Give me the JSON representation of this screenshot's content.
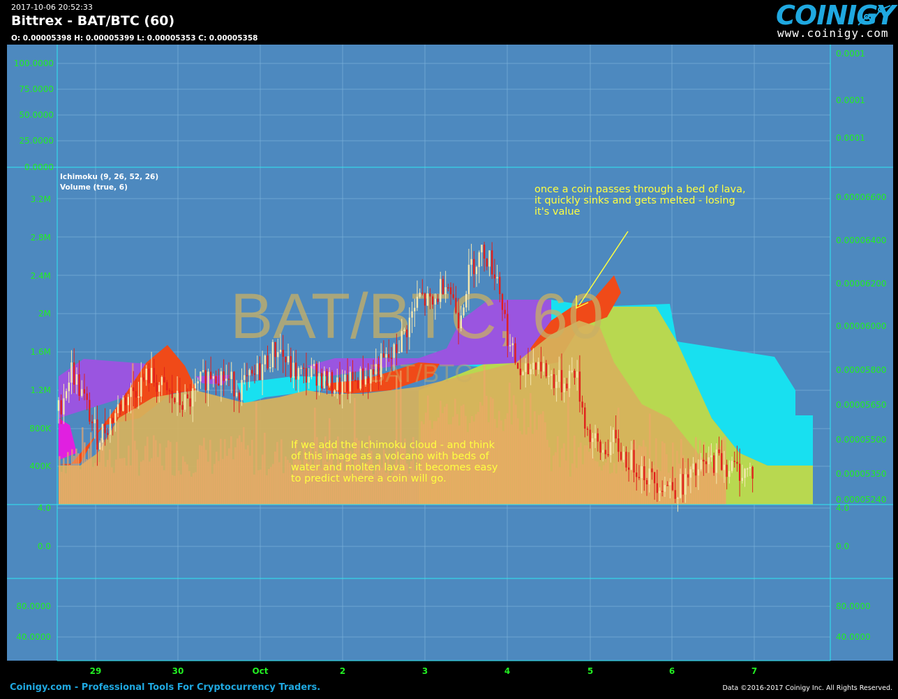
{
  "header": {
    "timestamp": "2017-10-06 20:52:33",
    "title": "Bittrex - BAT/BTC (60)",
    "ohlc": "O: 0.00005398 H: 0.00005399 L: 0.00005353 C: 0.00005358"
  },
  "logo": {
    "word": "COINIGY",
    "url": "www.coinigy.com"
  },
  "footer": {
    "left": "Coinigy.com - Professional Tools For Cryptocurrency Traders.",
    "right": "Data ©2016-2017 Coinigy Inc. All Rights Reserved."
  },
  "colors": {
    "panel_bg": "#4d89bf",
    "grid": "#7ab0d8",
    "axis_line": "#2ee8f0",
    "tick_text": "#22ee22",
    "candle_up": "#f5e8b0",
    "candle_down": "#e0201c",
    "cloud_purple": "#9a55e0",
    "cloud_lava": "#f04a18",
    "cloud_cyan": "#18e0f0",
    "cloud_lime": "#b8d850",
    "volume_fill": "#f0a868",
    "sand": "#d7b25c",
    "magenta": "#e020e0",
    "annotation": "#ffff40",
    "watermark": "#c8b064"
  },
  "chart_data": {
    "type": "candlestick",
    "watermark": "BAT/BTC, 60",
    "watermark_sub": "BAT/BTC",
    "indicators": [
      "Ichimoku (9, 26, 52, 26)",
      "Volume (true, 6)"
    ],
    "x_ticks": [
      "29",
      "30",
      "Oct",
      "2",
      "3",
      "4",
      "5",
      "6",
      "7"
    ],
    "top_panel": {
      "left_ticks": [
        "100.0000",
        "75.0000",
        "50.0000",
        "25.0000",
        "0.0000"
      ],
      "right_ticks": [
        "0.0001",
        "0.0001",
        "0.0001"
      ]
    },
    "main_panel": {
      "left_ticks": [
        "3.2M",
        "2.8M",
        "2.4M",
        "2M",
        "1.6M",
        "1.2M",
        "800K",
        "400K"
      ],
      "right_ticks": [
        "0.00006600",
        "0.00006400",
        "0.00006200",
        "0.00006000",
        "0.00005800",
        "0.00005650",
        "0.00005500",
        "0.00005350",
        "0.00005240"
      ],
      "price_range": [
        5.22e-05,
        6.68e-05
      ],
      "close_series": [
        {
          "x": 0.0,
          "c": 5.65e-05
        },
        {
          "x": 0.25,
          "c": 5.85e-05
        },
        {
          "x": 0.5,
          "c": 5.7e-05
        },
        {
          "x": 0.75,
          "c": 5.52e-05
        },
        {
          "x": 1.0,
          "c": 5.6e-05
        },
        {
          "x": 1.25,
          "c": 5.7e-05
        },
        {
          "x": 1.5,
          "c": 5.76e-05
        },
        {
          "x": 1.75,
          "c": 5.82e-05
        },
        {
          "x": 2.0,
          "c": 5.76e-05
        },
        {
          "x": 2.25,
          "c": 5.7e-05
        },
        {
          "x": 2.5,
          "c": 5.68e-05
        },
        {
          "x": 2.75,
          "c": 5.78e-05
        },
        {
          "x": 3.0,
          "c": 5.85e-05
        },
        {
          "x": 3.25,
          "c": 5.8e-05
        },
        {
          "x": 3.5,
          "c": 5.76e-05
        },
        {
          "x": 3.75,
          "c": 5.8e-05
        },
        {
          "x": 4.0,
          "c": 5.88e-05
        },
        {
          "x": 4.25,
          "c": 5.96e-05
        },
        {
          "x": 4.5,
          "c": 5.84e-05
        },
        {
          "x": 4.75,
          "c": 5.82e-05
        },
        {
          "x": 5.0,
          "c": 5.83e-05
        },
        {
          "x": 5.25,
          "c": 5.78e-05
        },
        {
          "x": 5.5,
          "c": 5.76e-05
        },
        {
          "x": 5.75,
          "c": 5.8e-05
        },
        {
          "x": 6.0,
          "c": 5.82e-05
        },
        {
          "x": 6.25,
          "c": 5.87e-05
        },
        {
          "x": 6.5,
          "c": 5.92e-05
        },
        {
          "x": 6.75,
          "c": 6.05e-05
        },
        {
          "x": 7.0,
          "c": 6.2e-05
        },
        {
          "x": 7.25,
          "c": 6.15e-05
        },
        {
          "x": 7.5,
          "c": 6.3e-05
        },
        {
          "x": 7.75,
          "c": 6.1e-05
        },
        {
          "x": 8.0,
          "c": 6.35e-05
        },
        {
          "x": 8.25,
          "c": 6.42e-05
        },
        {
          "x": 8.5,
          "c": 6.3e-05
        },
        {
          "x": 8.75,
          "c": 5.95e-05
        },
        {
          "x": 9.0,
          "c": 5.8e-05
        },
        {
          "x": 9.25,
          "c": 5.9e-05
        },
        {
          "x": 9.5,
          "c": 5.82e-05
        },
        {
          "x": 9.75,
          "c": 5.78e-05
        },
        {
          "x": 10.0,
          "c": 5.85e-05
        },
        {
          "x": 10.25,
          "c": 5.55e-05
        },
        {
          "x": 10.5,
          "c": 5.45e-05
        },
        {
          "x": 10.75,
          "c": 5.5e-05
        },
        {
          "x": 11.0,
          "c": 5.42e-05
        },
        {
          "x": 11.25,
          "c": 5.38e-05
        },
        {
          "x": 11.5,
          "c": 5.32e-05
        },
        {
          "x": 11.75,
          "c": 5.3e-05
        },
        {
          "x": 12.0,
          "c": 5.28e-05
        },
        {
          "x": 12.25,
          "c": 5.33e-05
        },
        {
          "x": 12.5,
          "c": 5.38e-05
        },
        {
          "x": 12.75,
          "c": 5.42e-05
        },
        {
          "x": 13.0,
          "c": 5.38e-05
        },
        {
          "x": 13.25,
          "c": 5.36e-05
        }
      ],
      "annotations": [
        {
          "text": "once a coin passes through a bed of lava,\nit quickly sinks and gets melted - losing\nit's value"
        },
        {
          "text": "If we add the Ichimoku cloud - and think\nof this image as a volcano with beds of\nwater and molten lava - it becomes easy\nto predict where a coin will go."
        }
      ]
    },
    "osc_panel": {
      "left_ticks": [
        "4.0",
        "0.0"
      ],
      "right_ticks": [
        "4.0",
        "0.0"
      ]
    },
    "bottom_panel": {
      "left_ticks": [
        "80.0000",
        "40.0000"
      ],
      "right_ticks": [
        "80.0000",
        "40.0000"
      ]
    }
  }
}
